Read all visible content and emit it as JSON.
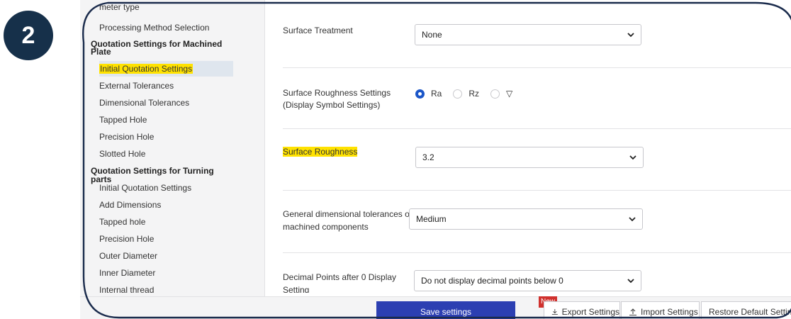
{
  "step_badge": "2",
  "sidebar": {
    "top_clipped": "meter type",
    "processing_method": "Processing Method Selection",
    "machined_heading_line1": "Quotation Settings for Machined",
    "machined_heading_line2": "Plate",
    "machined_items": [
      "Initial Quotation Settings",
      "External Tolerances",
      "Dimensional Tolerances",
      "Tapped Hole",
      "Precision Hole",
      "Slotted Hole"
    ],
    "turning_heading": "Quotation Settings for Turning parts",
    "turning_items": [
      "Initial Quotation Settings",
      "Add Dimensions",
      "Tapped hole",
      "Precision Hole",
      "Outer Diameter",
      "Inner Diameter",
      "Internal thread"
    ]
  },
  "settings": {
    "surface_treatment": {
      "label": "Surface Treatment",
      "value": "None"
    },
    "roughness_display": {
      "label_line1": "Surface Roughness Settings",
      "label_line2": "(Display Symbol Settings)",
      "options": [
        "Ra",
        "Rz",
        "▽"
      ],
      "selected": "Ra"
    },
    "surface_roughness": {
      "label": "Surface Roughness",
      "value": "3.2"
    },
    "general_tolerances": {
      "label_line1": "General dimensional tolerances of",
      "label_line2": "machined components",
      "value": "Medium"
    },
    "decimal_points": {
      "label_line1": "Decimal Points after 0 Display",
      "label_line2": "Setting",
      "value": "Do not display decimal points below 0"
    }
  },
  "footer": {
    "save_label": "Save settings",
    "new_badge": "New",
    "export_label": "Export Settings",
    "import_label": "Import Settings",
    "restore_label": "Restore Default Settings"
  },
  "colors": {
    "accent": "#2c3fb2",
    "radio_selected": "#1b56c8",
    "highlight": "#ffe200",
    "badge_bg": "#16304a",
    "new_badge": "#d0312d"
  }
}
